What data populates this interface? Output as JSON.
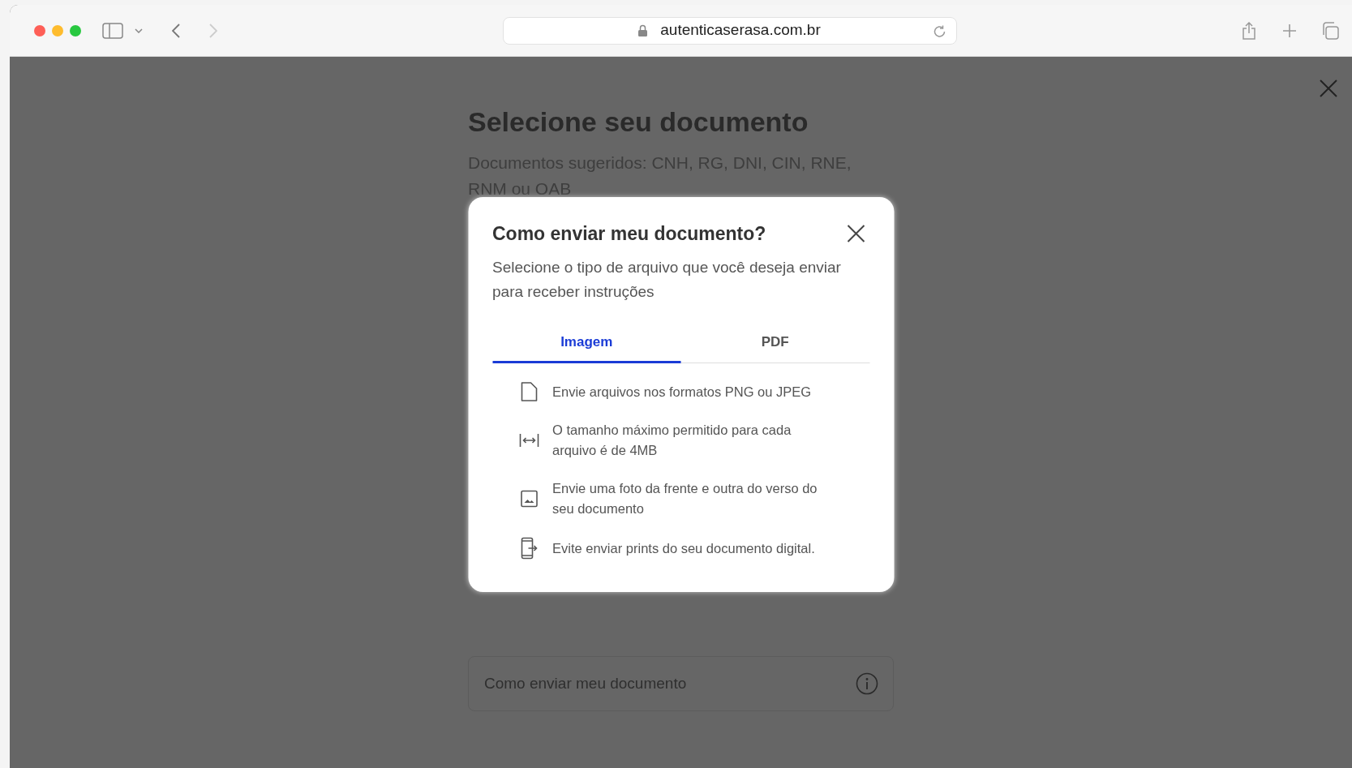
{
  "browser": {
    "address": "autenticaserasa.com.br"
  },
  "page": {
    "title": "Selecione seu documento",
    "subtitle": "Documentos sugeridos: CNH, RG, DNI, CIN, RNE, RNM ou OAB",
    "help_card": {
      "label": "Como enviar meu documento"
    }
  },
  "modal": {
    "title": "Como enviar meu documento?",
    "description": "Selecione o tipo de arquivo que você deseja enviar para receber instruções",
    "tabs": [
      {
        "label": "Imagem",
        "selected": true
      },
      {
        "label": "PDF",
        "selected": false
      }
    ],
    "items": [
      {
        "kind": "file",
        "text": "Envie arquivos nos formatos PNG ou JPEG"
      },
      {
        "kind": "size",
        "text": "O tamanho máximo permitido para cada arquivo é de 4MB"
      },
      {
        "kind": "image",
        "text": "Envie uma foto da frente e outra do verso do seu documento"
      },
      {
        "kind": "phone",
        "text": "Evite enviar prints do seu documento digital."
      }
    ]
  }
}
